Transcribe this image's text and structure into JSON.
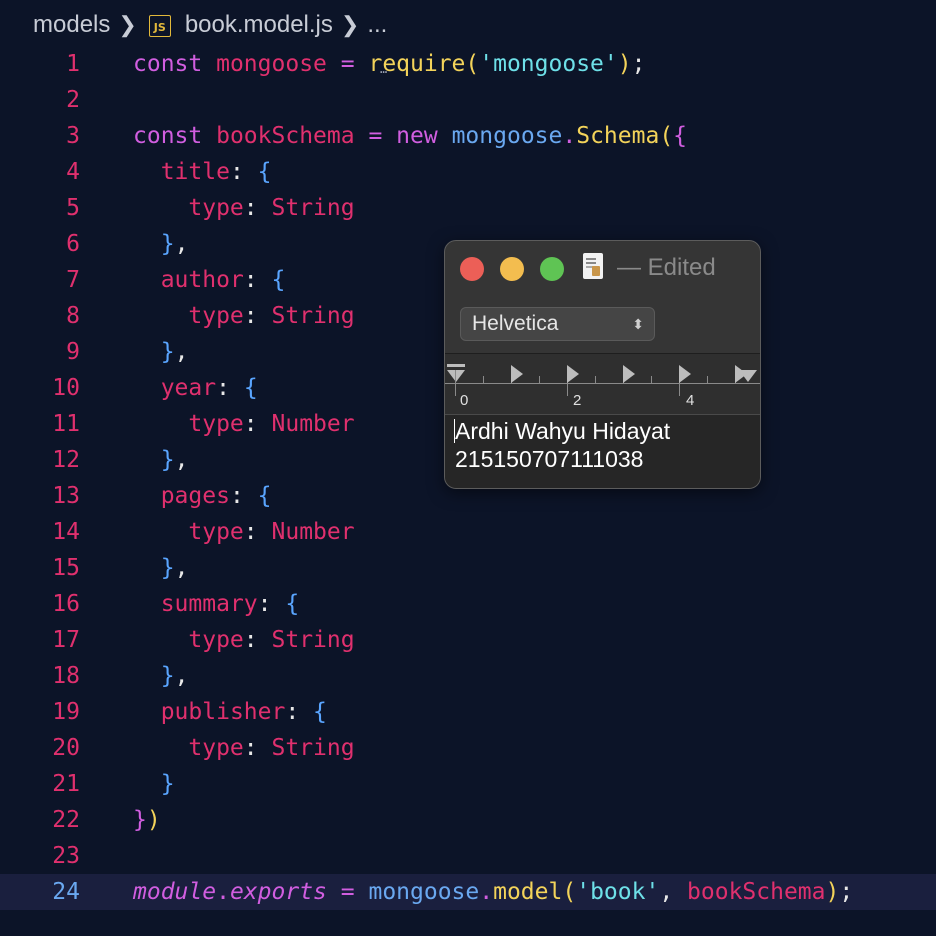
{
  "breadcrumb": {
    "folder": "models",
    "file_icon_label": "JS",
    "file": "book.model.js",
    "more": "..."
  },
  "editor": {
    "current_line": 24,
    "line_numbers": [
      "1",
      "2",
      "3",
      "4",
      "5",
      "6",
      "7",
      "8",
      "9",
      "10",
      "11",
      "12",
      "13",
      "14",
      "15",
      "16",
      "17",
      "18",
      "19",
      "20",
      "21",
      "22",
      "23",
      "24"
    ],
    "lines": [
      "const mongoose = require('mongoose');",
      "",
      "const bookSchema = new mongoose.Schema({",
      "  title: {",
      "    type: String",
      "  },",
      "  author: {",
      "    type: String",
      "  },",
      "  year: {",
      "    type: Number",
      "  },",
      "  pages: {",
      "    type: Number",
      "  },",
      "  summary: {",
      "    type: String",
      "  },",
      "  publisher: {",
      "    type: String",
      "  }",
      "})",
      "",
      "module.exports = mongoose.model('book', bookSchema);"
    ]
  },
  "textedit": {
    "title": "— Edited",
    "font": "Helvetica",
    "ruler_labels": [
      "0",
      "2",
      "4"
    ],
    "content_line1": "Ardhi Wahyu Hidayat",
    "content_line2": "215150707111038"
  },
  "colors": {
    "background": "#0c1428",
    "line_number": "#e0306e",
    "current_line_number": "#6aa8f0",
    "keyword": "#d15ee0",
    "function": "#f3d35a",
    "string": "#6ee0e8"
  }
}
